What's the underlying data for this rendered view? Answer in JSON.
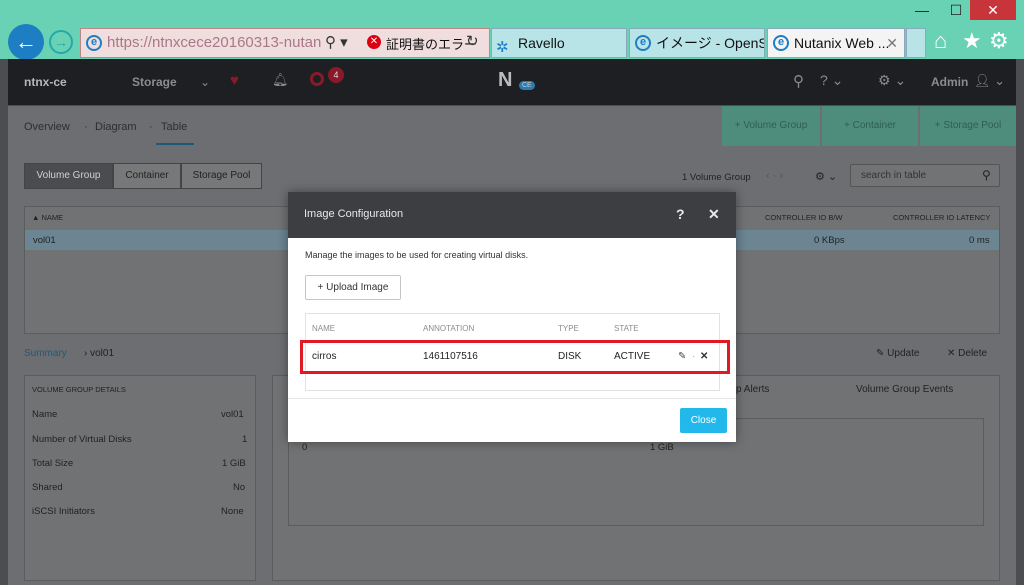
{
  "window": {
    "min": "—",
    "max": "☐",
    "close": "✕"
  },
  "browser": {
    "address": "https://ntnxcece20160313-nutan",
    "cert_error": "証明書のエラー",
    "tabs": [
      {
        "label": "Ravello"
      },
      {
        "label": "イメージ - OpenSt..."
      },
      {
        "label": "Nutanix Web ..."
      }
    ]
  },
  "nav": {
    "cluster": "ntnx-ce",
    "menu": "Storage",
    "alerts_count": "4",
    "user": "Admin"
  },
  "subnav": {
    "links": [
      "Overview",
      "Diagram",
      "Table"
    ],
    "sep": "·",
    "actions": [
      "+ Volume Group",
      "+ Container",
      "+ Storage Pool"
    ]
  },
  "segments": [
    "Volume Group",
    "Container",
    "Storage Pool"
  ],
  "toolbar": {
    "count": "1 Volume Group",
    "search_placeholder": "search in table"
  },
  "table": {
    "headers": [
      "▲ NAME",
      "CONTROLLER IO B/W",
      "CONTROLLER IO LATENCY"
    ],
    "row": {
      "name": "vol01",
      "bw": "0 KBps",
      "latency": "0 ms"
    }
  },
  "summary": {
    "crumb": "Summary",
    "crumb_item": "vol01",
    "update": "Update",
    "delete": "Delete",
    "details_title": "VOLUME GROUP DETAILS",
    "details": [
      {
        "k": "Name",
        "v": "vol01"
      },
      {
        "k": "Number of Virtual Disks",
        "v": "1"
      },
      {
        "k": "Total Size",
        "v": "1 GiB"
      },
      {
        "k": "Shared",
        "v": "No"
      },
      {
        "k": "iSCSI Initiators",
        "v": "None"
      }
    ],
    "tabs": [
      "p Alerts",
      "Volume Group Events"
    ],
    "disk_row": {
      "index": "0",
      "size": "1 GiB"
    }
  },
  "modal": {
    "title": "Image Configuration",
    "help": "?",
    "close_x": "✕",
    "desc": "Manage the images to be used for creating virtual disks.",
    "upload": "+ Upload Image",
    "headers": [
      "NAME",
      "ANNOTATION",
      "TYPE",
      "STATE"
    ],
    "row": {
      "name": "cirros",
      "annotation": "1461107516",
      "type": "DISK",
      "state": "ACTIVE"
    },
    "close": "Close"
  }
}
